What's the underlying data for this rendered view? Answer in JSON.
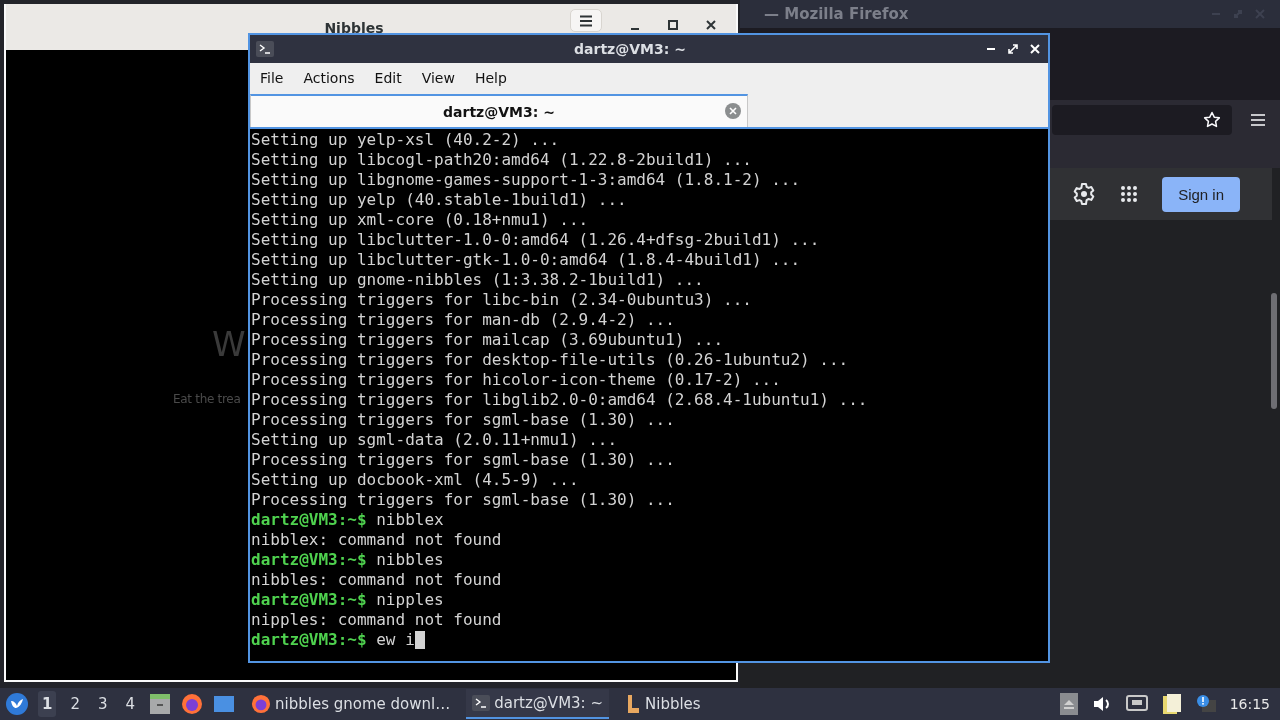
{
  "firefox_window": {
    "title": "— Mozilla Firefox",
    "sign_in": "Sign in"
  },
  "nibbles_window": {
    "title": "Nibbles",
    "heading_partial": "W",
    "subtitle_partial": "Eat the trea"
  },
  "terminal": {
    "title": "dartz@VM3: ~",
    "menu": [
      "File",
      "Actions",
      "Edit",
      "View",
      "Help"
    ],
    "tabs": [
      {
        "label": "dartz@VM3: ~",
        "selected": true
      }
    ],
    "lines": [
      "Setting up yelp-xsl (40.2-2) ...",
      "Setting up libcogl-path20:amd64 (1.22.8-2build1) ...",
      "Setting up libgnome-games-support-1-3:amd64 (1.8.1-2) ...",
      "Setting up yelp (40.stable-1build1) ...",
      "Setting up xml-core (0.18+nmu1) ...",
      "Setting up libclutter-1.0-0:amd64 (1.26.4+dfsg-2build1) ...",
      "Setting up libclutter-gtk-1.0-0:amd64 (1.8.4-4build1) ...",
      "Setting up gnome-nibbles (1:3.38.2-1build1) ...",
      "Processing triggers for libc-bin (2.34-0ubuntu3) ...",
      "Processing triggers for man-db (2.9.4-2) ...",
      "Processing triggers for mailcap (3.69ubuntu1) ...",
      "Processing triggers for desktop-file-utils (0.26-1ubuntu2) ...",
      "Processing triggers for hicolor-icon-theme (0.17-2) ...",
      "Processing triggers for libglib2.0-0:amd64 (2.68.4-1ubuntu1) ...",
      "Processing triggers for sgml-base (1.30) ...",
      "Setting up sgml-data (2.0.11+nmu1) ...",
      "Processing triggers for sgml-base (1.30) ...",
      "Setting up docbook-xml (4.5-9) ...",
      "Processing triggers for sgml-base (1.30) ...",
      "**dartz@VM3:~$** nibblex",
      "nibblex: command not found",
      "**dartz@VM3:~$** nibbles",
      "nibbles: command not found",
      "**dartz@VM3:~$** nipples",
      "nipples: command not found",
      "**dartz@VM3:~$** ew i"
    ],
    "cursor_visible": true
  },
  "taskbar": {
    "workspaces": [
      {
        "label": "1",
        "selected": true
      },
      {
        "label": "2",
        "selected": false
      },
      {
        "label": "3",
        "selected": false
      },
      {
        "label": "4",
        "selected": false
      }
    ],
    "tasks": [
      {
        "kind": "browser",
        "label": "nibbles gnome downl…",
        "selected": false
      },
      {
        "kind": "terminal",
        "label": "dartz@VM3: ~",
        "selected": true
      },
      {
        "kind": "game",
        "label": "Nibbles",
        "selected": false
      }
    ],
    "clock": "16:15"
  }
}
